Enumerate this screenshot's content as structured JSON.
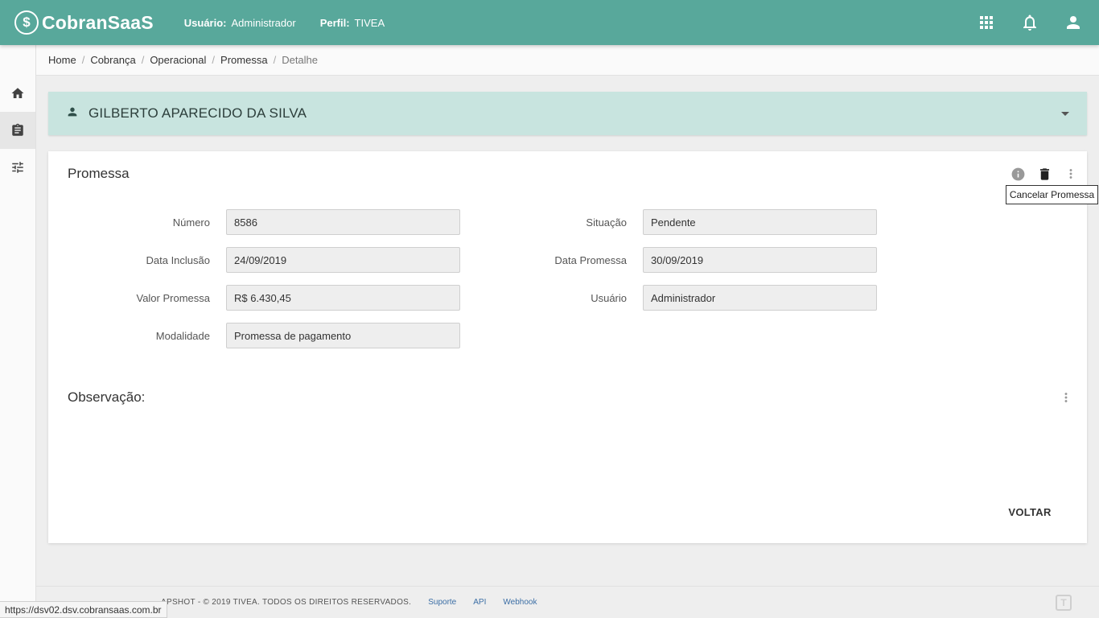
{
  "header": {
    "logo_symbol": "$",
    "logo_text": "CobranSaaS",
    "user_label": "Usuário:",
    "user_value": "Administrador",
    "profile_label": "Perfil:",
    "profile_value": "TIVEA",
    "icons": [
      "apps-icon",
      "bell-icon",
      "account-icon"
    ],
    "color": "#58a89b"
  },
  "sidebar": {
    "items": [
      {
        "name": "home",
        "icon": "home-icon",
        "active": false
      },
      {
        "name": "cobranca",
        "icon": "clipboard-icon",
        "active": true
      },
      {
        "name": "configuracoes",
        "icon": "sliders-icon",
        "active": false
      }
    ]
  },
  "breadcrumb": [
    "Home",
    "Cobrança",
    "Operacional",
    "Promessa",
    "Detalhe"
  ],
  "client": {
    "name": "GILBERTO APARECIDO DA SILVA",
    "icon": "person-icon",
    "color": "#c8e4df"
  },
  "promessa": {
    "title": "Promessa",
    "fields": {
      "numero": {
        "label": "Número",
        "value": "8586"
      },
      "situacao": {
        "label": "Situação",
        "value": "Pendente"
      },
      "data_inclusao": {
        "label": "Data Inclusão",
        "value": "24/09/2019"
      },
      "data_promessa": {
        "label": "Data Promessa",
        "value": "30/09/2019"
      },
      "valor_promessa": {
        "label": "Valor Promessa",
        "value": "R$ 6.430,45"
      },
      "usuario": {
        "label": "Usuário",
        "value": "Administrador"
      },
      "modalidade": {
        "label": "Modalidade",
        "value": "Promessa de pagamento"
      }
    },
    "tooltip": "Cancelar Promessa",
    "observacao_title": "Observação:",
    "back_label": "VOLTAR"
  },
  "footer": {
    "copyright": "APSHOT - © 2019 TIVEA. TODOS OS DIREITOS RESERVADOS.",
    "links": [
      "Suporte",
      "API",
      "Webhook"
    ],
    "brand_mark": "T"
  },
  "status_url": "https://dsv02.dsv.cobransaas.com.br"
}
